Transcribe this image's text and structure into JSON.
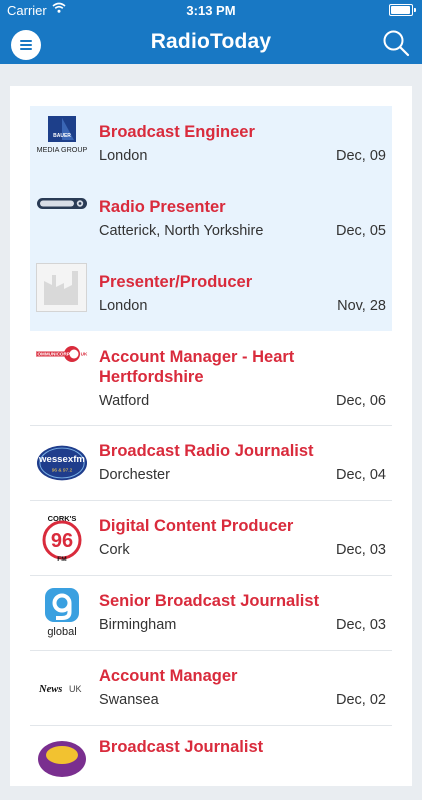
{
  "status": {
    "carrier": "Carrier",
    "time": "3:13 PM"
  },
  "nav": {
    "title": "RadioToday"
  },
  "jobs": [
    {
      "title": "Broadcast Engineer",
      "location": "London",
      "date": "Dec, 09",
      "logo": "BAUER MEDIA GROUP",
      "logo_top": "BAUER",
      "logo_bottom": "MEDIA GROUP"
    },
    {
      "title": "Radio Presenter",
      "location": "Catterick, North Yorkshire",
      "date": "Dec, 05",
      "logo": "forces radio"
    },
    {
      "title": "Presenter/Producer",
      "location": "London",
      "date": "Nov, 28",
      "logo": "placeholder"
    },
    {
      "title": "Account Manager - Heart Hertfordshire",
      "location": "Watford",
      "date": "Dec, 06",
      "logo": "COMMUNICORP UK"
    },
    {
      "title": "Broadcast Radio Journalist",
      "location": "Dorchester",
      "date": "Dec, 04",
      "logo": "wessex fm",
      "logo_word": "wessexfm",
      "logo_freq": "96 & 97.2"
    },
    {
      "title": "Digital Content Producer",
      "location": "Cork",
      "date": "Dec, 03",
      "logo": "CORK'S 96 FM",
      "logo_top": "CORK'S",
      "logo_num": "96",
      "logo_fm": "FM"
    },
    {
      "title": "Senior Broadcast Journalist",
      "location": "Birmingham",
      "date": "Dec, 03",
      "logo": "global",
      "logo_word": "global"
    },
    {
      "title": "Account Manager",
      "location": "Swansea",
      "date": "Dec, 02",
      "logo": "News UK",
      "logo_news": "News",
      "logo_uk": "UK"
    },
    {
      "title": "Broadcast Journalist",
      "location": "",
      "date": "",
      "logo": "station"
    }
  ],
  "colors": {
    "brand": "#1878c4",
    "title": "#d92b3c",
    "highlight": "#e8f3fd"
  }
}
